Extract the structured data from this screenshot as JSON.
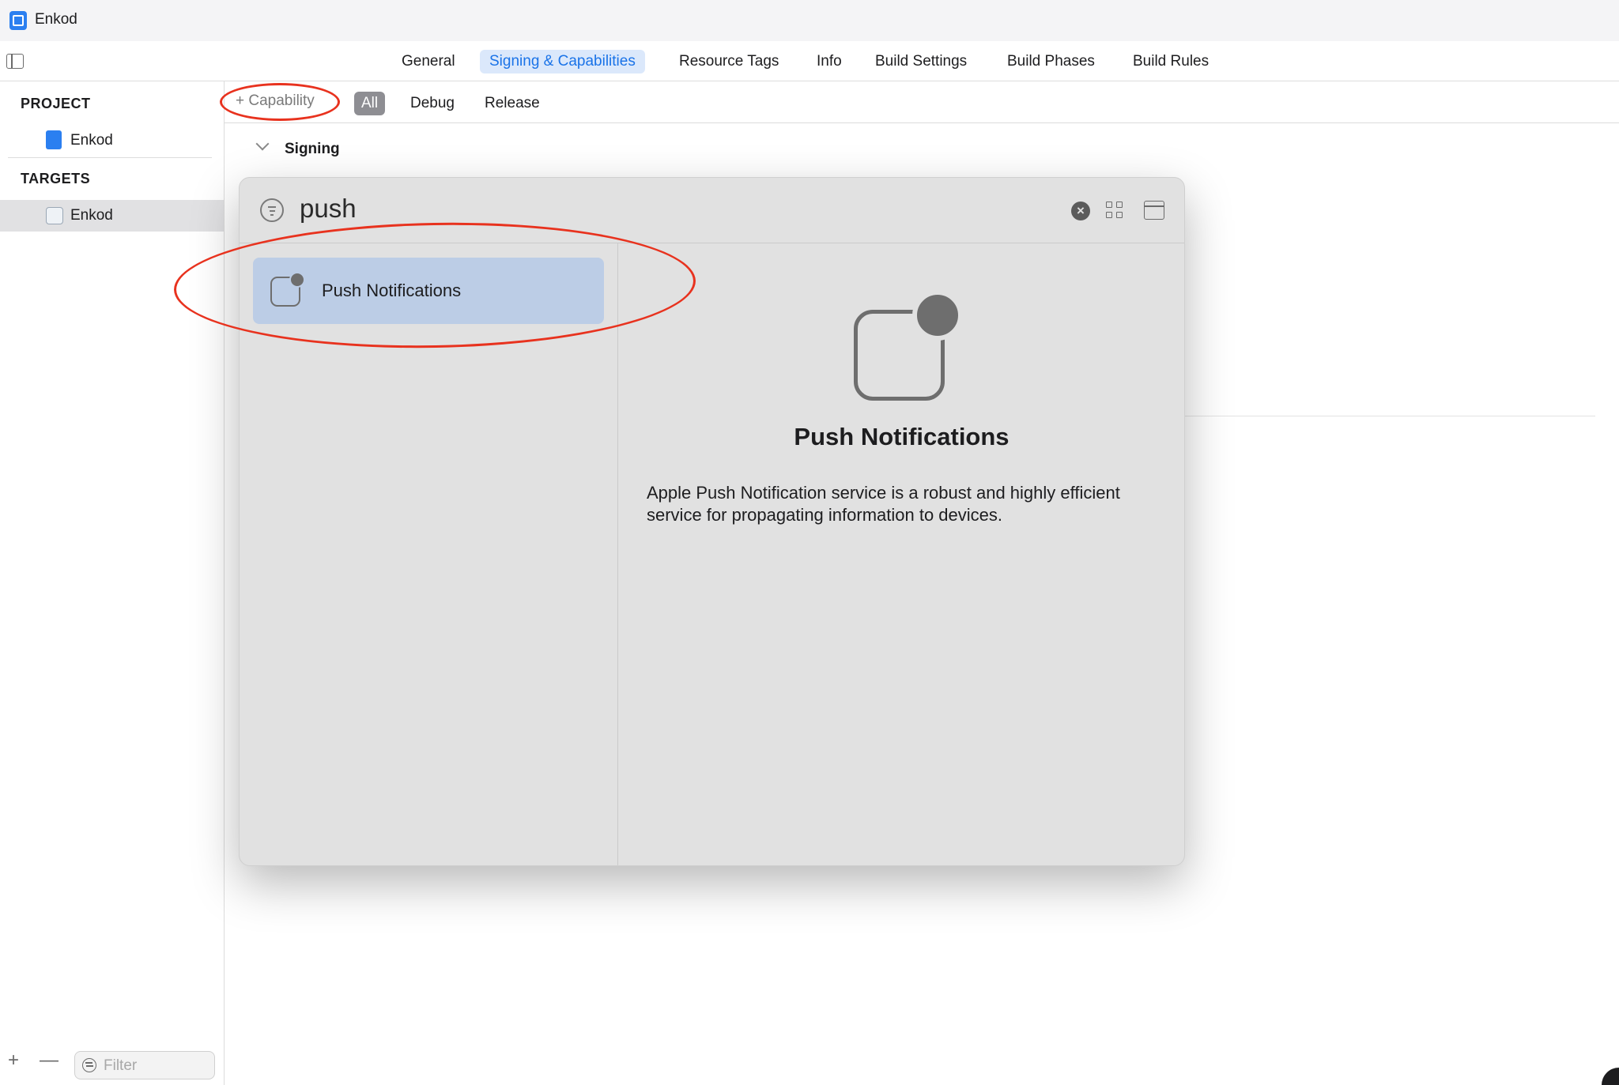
{
  "window": {
    "title": "Enkod"
  },
  "tabs": [
    {
      "label": "General",
      "active": false
    },
    {
      "label": "Signing & Capabilities",
      "active": true
    },
    {
      "label": "Resource Tags",
      "active": false
    },
    {
      "label": "Info",
      "active": false
    },
    {
      "label": "Build Settings",
      "active": false
    },
    {
      "label": "Build Phases",
      "active": false
    },
    {
      "label": "Build Rules",
      "active": false
    }
  ],
  "sidebar": {
    "project_header": "PROJECT",
    "project_item": "Enkod",
    "targets_header": "TARGETS",
    "target_item": "Enkod",
    "add_symbol": "+",
    "remove_symbol": "—",
    "filter_placeholder": "Filter"
  },
  "editor": {
    "capability_button": "+ Capability",
    "segments": [
      "All",
      "Debug",
      "Release"
    ],
    "active_segment": "All",
    "section_title": "Signing"
  },
  "popover": {
    "search_value": "push",
    "results": [
      {
        "label": "Push Notifications",
        "icon": "push-notifications-icon",
        "selected": true
      }
    ],
    "detail": {
      "title": "Push Notifications",
      "description": "Apple Push Notification service is a robust and highly efficient service for propagating information to devices."
    }
  },
  "annotations": {
    "highlight_color": "#e8321e"
  },
  "colors": {
    "accent": "#1a73e8",
    "selection": "#bccde6"
  }
}
